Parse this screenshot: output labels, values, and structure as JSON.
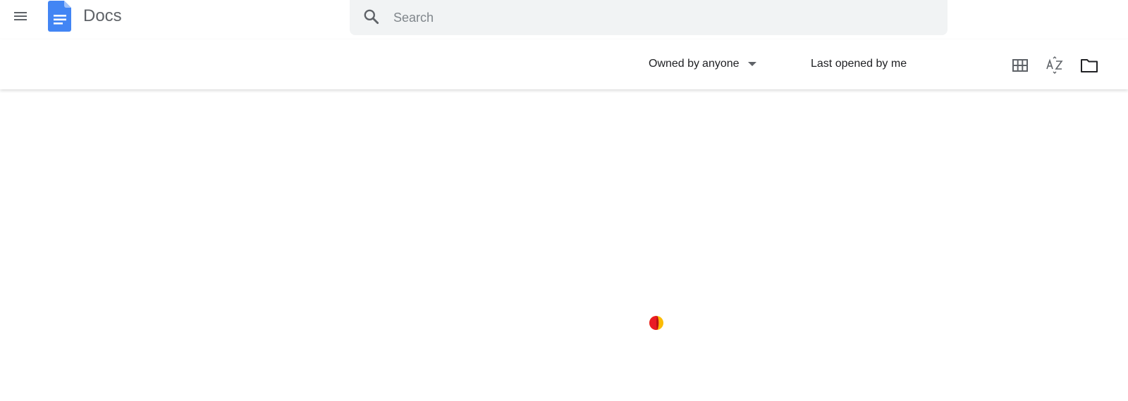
{
  "app": {
    "title": "Docs"
  },
  "icons": {
    "menu": "hamburger-menu-icon",
    "logo": "docs-logo-icon",
    "search": "search-icon",
    "grid": "grid-view-icon",
    "sort": "sort-az-icon",
    "folder": "folder-icon",
    "spinner": "loading-spinner-icon"
  },
  "search": {
    "placeholder": "Search",
    "value": ""
  },
  "toolbar": {
    "owner_prefix": "Owned by",
    "owner_value": "anyone",
    "sort_label": "Last opened by me"
  },
  "colors": {
    "brand_blue": "#4285f4",
    "search_bg": "#f1f3f4",
    "spinner_red": "#ea1c24",
    "spinner_yellow": "#fbbc04"
  }
}
